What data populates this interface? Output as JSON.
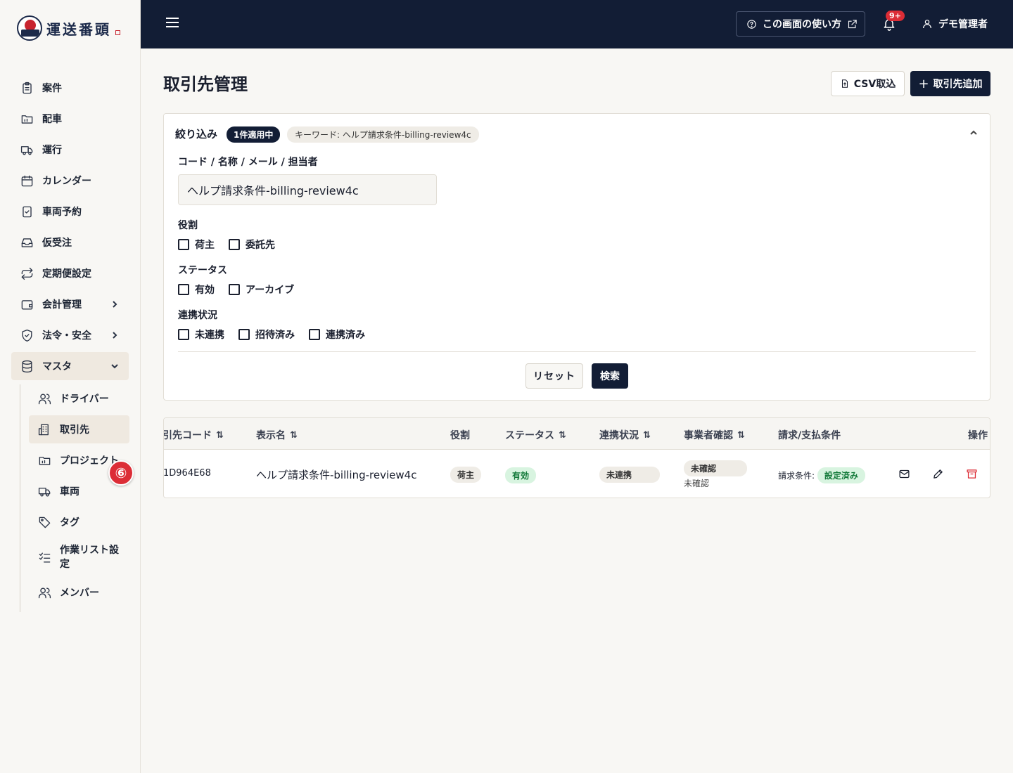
{
  "brand": {
    "name": "運送番頭"
  },
  "header": {
    "help_label": "この画面の使い方",
    "notification_count": "9+",
    "user_name": "デモ管理者"
  },
  "sidebar": {
    "items": [
      {
        "label": "案件",
        "icon": "clipboard-icon"
      },
      {
        "label": "配車",
        "icon": "folder-icon"
      },
      {
        "label": "運行",
        "icon": "truck-icon"
      },
      {
        "label": "カレンダー",
        "icon": "calendar-icon"
      },
      {
        "label": "車両予約",
        "icon": "clipboard-check-icon"
      },
      {
        "label": "仮受注",
        "icon": "inbox-icon"
      },
      {
        "label": "定期便設定",
        "icon": "repeat-icon"
      },
      {
        "label": "会計管理",
        "icon": "wallet-icon"
      },
      {
        "label": "法令・安全",
        "icon": "shield-icon"
      },
      {
        "label": "マスタ",
        "icon": "database-icon"
      }
    ],
    "sub_items": [
      {
        "label": "ドライバー",
        "icon": "users-icon"
      },
      {
        "label": "取引先",
        "icon": "building-icon"
      },
      {
        "label": "プロジェクト",
        "icon": "folder-icon"
      },
      {
        "label": "車両",
        "icon": "truck-icon"
      },
      {
        "label": "タグ",
        "icon": "tag-icon"
      },
      {
        "label": "作業リスト設定",
        "icon": "checklist-icon"
      },
      {
        "label": "メンバー",
        "icon": "users-icon"
      }
    ],
    "step_badge": "⑥"
  },
  "page": {
    "title": "取引先管理",
    "csv_label": "CSV取込",
    "add_label": "取引先追加"
  },
  "filter": {
    "title": "絞り込み",
    "applied_badge": "1件適用中",
    "keyword_chip": "キーワード: ヘルプ請求条件-billing-review4c",
    "search_label": "コード / 名称 / メール / 担当者",
    "search_value": "ヘルプ請求条件-billing-review4c",
    "role_label": "役割",
    "role_options": [
      "荷主",
      "委託先"
    ],
    "status_label": "ステータス",
    "status_options": [
      "有効",
      "アーカイブ"
    ],
    "link_label": "連携状況",
    "link_options": [
      "未連携",
      "招待済み",
      "連携済み"
    ],
    "reset_label": "リセット",
    "search_button": "検索"
  },
  "table": {
    "headers": {
      "code": "引先コード",
      "name": "表示名",
      "role": "役割",
      "status": "ステータス",
      "link": "連携状況",
      "verify": "事業者確認",
      "terms": "請求/支払条件",
      "actions": "操作"
    },
    "rows": [
      {
        "code": "1D964E68",
        "name": "ヘルプ請求条件-billing-review4c",
        "role": "荷主",
        "status": "有効",
        "link": "未連携",
        "verify": "未確認",
        "verify_sub": "未確認",
        "terms_label": "請求条件:",
        "terms_value": "設定済み"
      }
    ]
  },
  "colors": {
    "navy": "#121d35",
    "danger": "#dc2d36",
    "success_bg": "#d8f4e0",
    "success_text": "#137a3a"
  }
}
